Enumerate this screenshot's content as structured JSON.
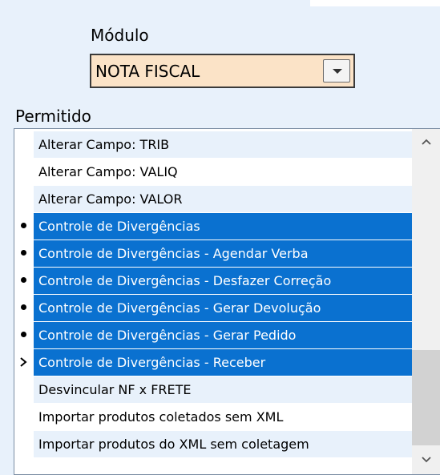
{
  "modulo": {
    "label": "Módulo",
    "value": "NOTA FISCAL"
  },
  "permitido": {
    "label": "Permitido",
    "items": [
      {
        "label": "Alterar Campo: TRIB",
        "state": "alt"
      },
      {
        "label": "Alterar Campo: VALIQ",
        "state": "plain"
      },
      {
        "label": "Alterar Campo: VALOR",
        "state": "alt"
      },
      {
        "label": "Controle de Divergências",
        "state": "sel",
        "marker": "bullet"
      },
      {
        "label": "Controle de Divergências - Agendar Verba",
        "state": "sel",
        "marker": "bullet"
      },
      {
        "label": "Controle de Divergências - Desfazer Correção",
        "state": "sel",
        "marker": "bullet"
      },
      {
        "label": "Controle de Divergências - Gerar Devolução",
        "state": "sel",
        "marker": "bullet"
      },
      {
        "label": "Controle de Divergências - Gerar Pedido",
        "state": "sel",
        "marker": "bullet"
      },
      {
        "label": "Controle de Divergências - Receber",
        "state": "sel",
        "marker": "arrow"
      },
      {
        "label": "Desvincular NF x FRETE",
        "state": "alt"
      },
      {
        "label": "Importar produtos coletados sem XML",
        "state": "plain"
      },
      {
        "label": "Importar produtos do XML sem coletagem",
        "state": "alt"
      }
    ]
  },
  "colors": {
    "selected": "#0a71d0",
    "alt_row": "#e8f1fb",
    "select_bg": "#fbe3c7"
  }
}
